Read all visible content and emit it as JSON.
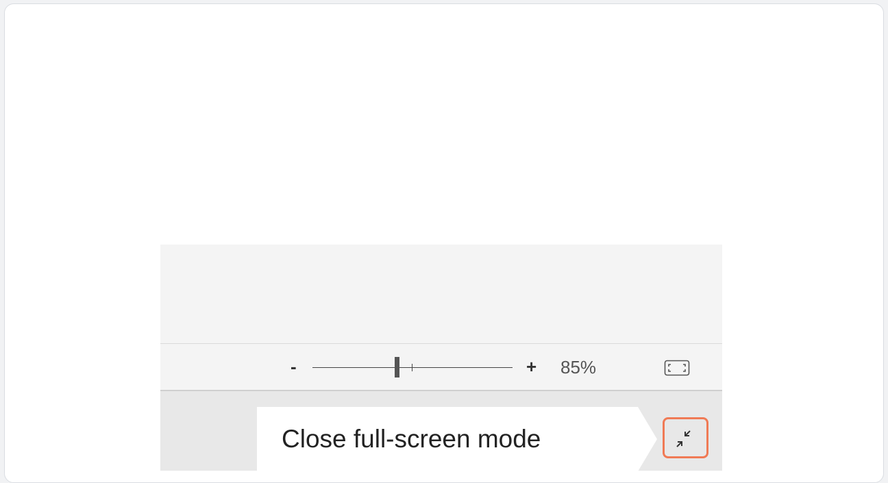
{
  "statusbar": {
    "zoom_out_label": "-",
    "zoom_in_label": "+",
    "zoom_value": "85%",
    "zoom_percent": 85,
    "fit_icon": "fit-to-window-icon"
  },
  "tooltip": {
    "text": "Close full-screen mode"
  },
  "exit_fullscreen": {
    "icon": "exit-fullscreen-icon",
    "highlight_color": "#f07a55"
  }
}
